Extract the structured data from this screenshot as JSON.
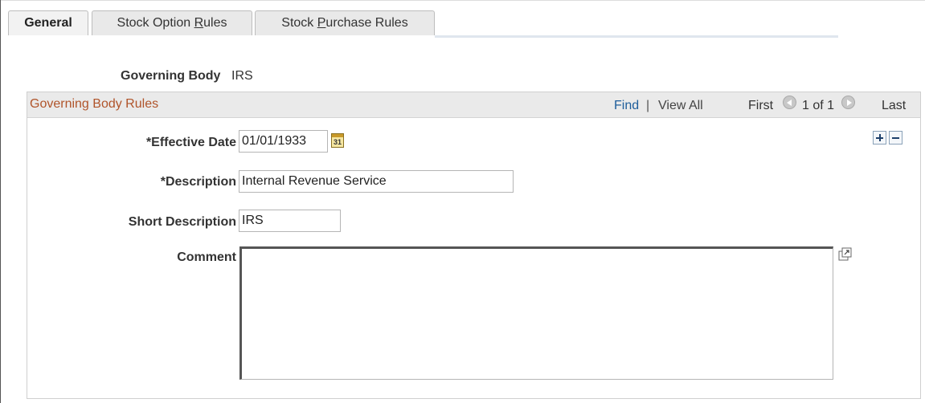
{
  "tabs": [
    {
      "label": "General",
      "active": true
    },
    {
      "label_before": "Stock Option ",
      "label_underlined": "R",
      "label_after": "ules"
    },
    {
      "label_before": "Stock ",
      "label_underlined": "P",
      "label_after": "urchase Rules"
    }
  ],
  "governing_body": {
    "label": "Governing Body",
    "value": "IRS"
  },
  "group": {
    "title": "Governing Body Rules",
    "find": "Find",
    "separator": "|",
    "view_all": "View All",
    "first": "First",
    "range": "1 of 1",
    "last": "Last"
  },
  "fields": {
    "effective_date": {
      "label": "*Effective Date",
      "value": "01/01/1933"
    },
    "description": {
      "label": "*Description",
      "value": "Internal Revenue Service"
    },
    "short_description": {
      "label": "Short Description",
      "value": "IRS"
    },
    "comment": {
      "label": "Comment",
      "value": ""
    }
  },
  "calendar_icon_text": "31",
  "icons": [
    "calendar-icon",
    "add-row-icon",
    "delete-row-icon",
    "expand-icon",
    "resize-grip-icon",
    "prev-icon",
    "next-icon"
  ],
  "colors": {
    "title": "#b0542a",
    "link": "#1d5d9b",
    "header_bg": "#eaeaea"
  }
}
